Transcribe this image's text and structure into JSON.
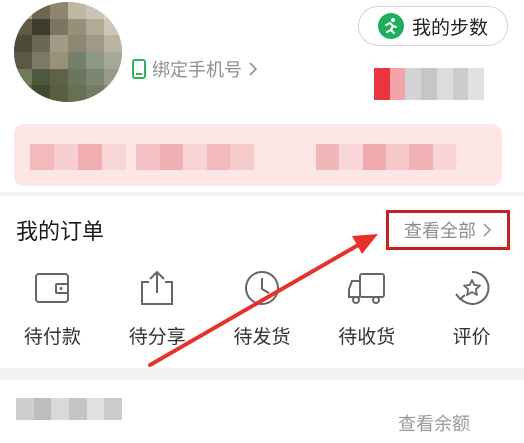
{
  "header": {
    "bind_phone_label": "绑定手机号",
    "steps_button_label": "我的步数"
  },
  "orders": {
    "title": "我的订单",
    "view_all_label": "查看全部",
    "statuses": [
      {
        "label": "待付款",
        "icon": "wallet-icon"
      },
      {
        "label": "待分享",
        "icon": "share-icon"
      },
      {
        "label": "待发货",
        "icon": "clock-icon"
      },
      {
        "label": "待收货",
        "icon": "truck-icon"
      },
      {
        "label": "评价",
        "icon": "star-icon"
      }
    ]
  },
  "wallet": {
    "view_balance_label": "查看余额"
  },
  "colors": {
    "highlight_box": "#c8201e",
    "annotation_arrow": "#e8312a",
    "steps_icon_bg": "#1fae5e",
    "banner_bg": "#fde6e6"
  }
}
